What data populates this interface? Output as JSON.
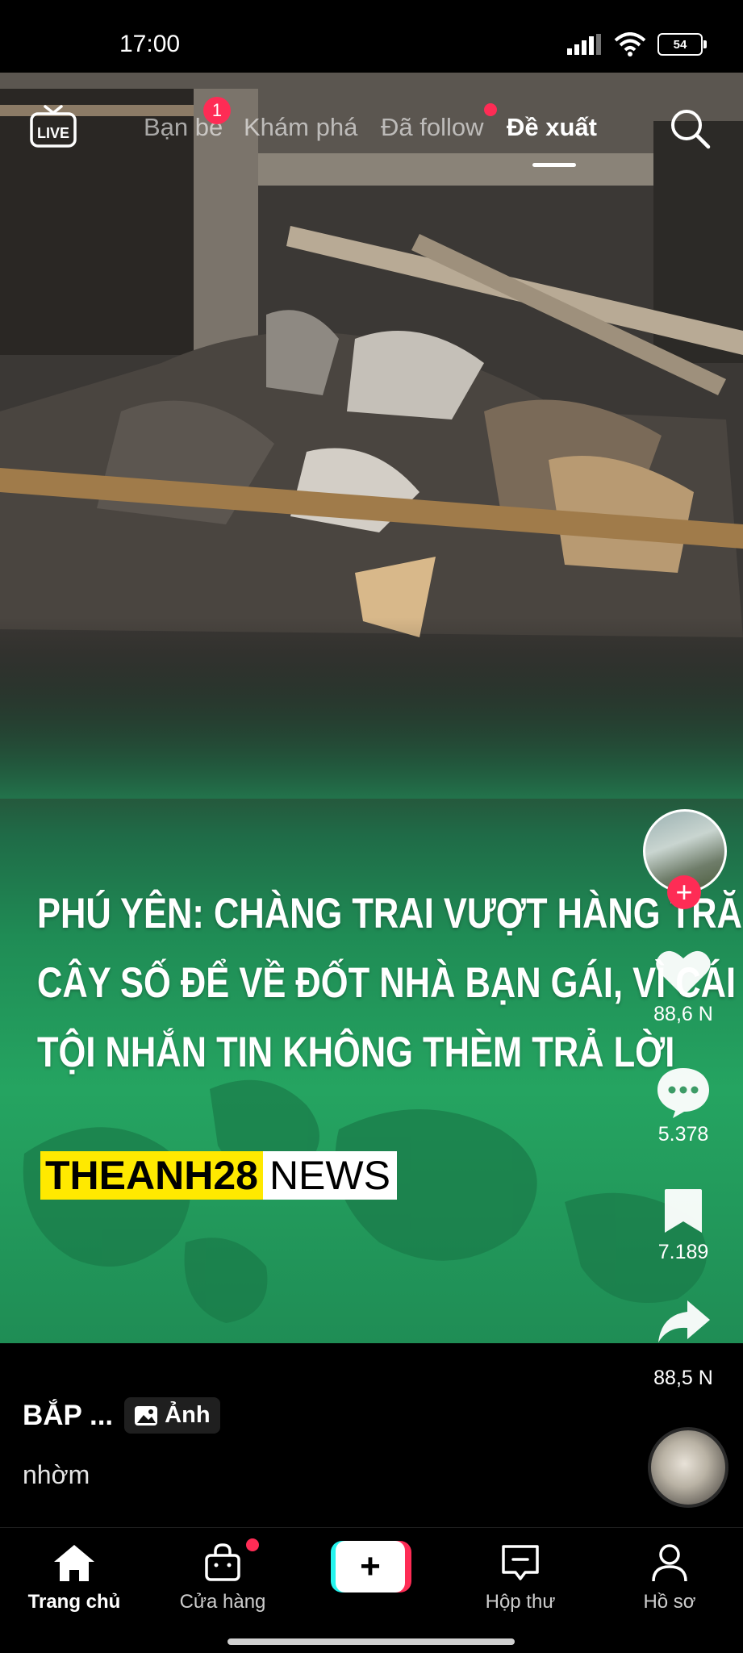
{
  "status_bar": {
    "time": "17:00",
    "battery": "54"
  },
  "top_nav": {
    "live_label": "LIVE",
    "tabs": [
      {
        "label": "Bạn bè",
        "badge": "1"
      },
      {
        "label": "Khám phá"
      },
      {
        "label": "Đã follow",
        "has_dot": true
      },
      {
        "label": "Đề xuất",
        "active": true
      }
    ]
  },
  "video": {
    "headline_lines": [
      "PHÚ YÊN: CHÀNG TRAI VƯỢT HÀNG TRĂ",
      "CÂY SỐ ĐỂ VỀ ĐỐT NHÀ BẠN GÁI, VÌ CÁI",
      "TỘI NHẮN TIN KHÔNG THÈM TRẢ LỜI"
    ],
    "brand_part1": "THEANH28",
    "brand_part2": "NEWS"
  },
  "actions": {
    "likes": "88,6 N",
    "comments": "5.378",
    "saves": "7.189",
    "shares": "88,5 N"
  },
  "caption": {
    "author": "BẮP ...",
    "tag": "Ảnh",
    "description": "nhờm"
  },
  "bottom_nav": {
    "items": [
      {
        "label": "Trang chủ",
        "icon": "home-icon",
        "active": true
      },
      {
        "label": "Cửa hàng",
        "icon": "shop-bag-icon",
        "has_dot": true
      },
      {
        "label": "",
        "icon": "plus-icon"
      },
      {
        "label": "Hộp thư",
        "icon": "inbox-icon"
      },
      {
        "label": "Hồ sơ",
        "icon": "profile-icon"
      }
    ]
  },
  "colors": {
    "accent": "#fe2c55",
    "cyan": "#25f4ee",
    "brand_yellow": "#ffe900",
    "overlay_green": "#22a05c"
  }
}
